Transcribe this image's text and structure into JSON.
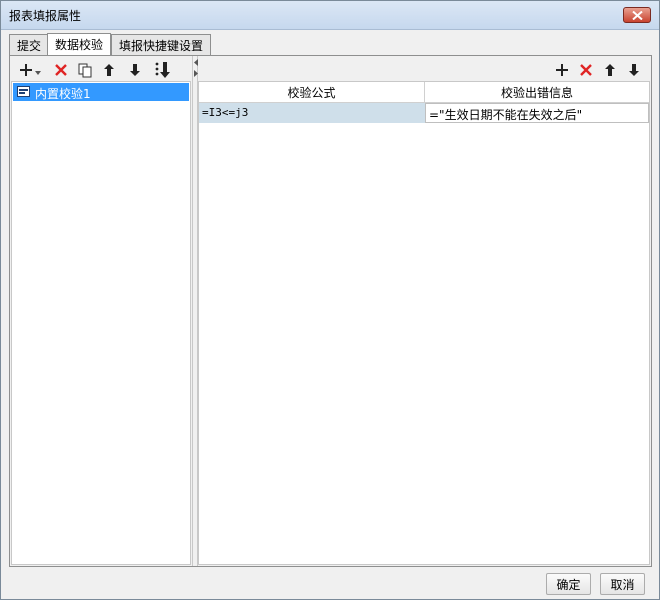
{
  "window": {
    "title": "报表填报属性"
  },
  "tabs": [
    {
      "label": "提交",
      "active": false
    },
    {
      "label": "数据校验",
      "active": true
    },
    {
      "label": "填报快捷键设置",
      "active": false
    }
  ],
  "left_list": {
    "items": [
      {
        "label": "内置校验1",
        "selected": true
      }
    ]
  },
  "grid": {
    "columns": [
      "校验公式",
      "校验出错信息"
    ],
    "rows": [
      {
        "formula": "=I3<=j3",
        "message": "=\"生效日期不能在失效之后\""
      }
    ]
  },
  "footer": {
    "ok_label": "确定",
    "cancel_label": "取消"
  },
  "colors": {
    "selection": "#3399ff",
    "delete": "#e02424",
    "formula_cell_bg": "#cfdfea"
  },
  "icons": [
    "add-icon",
    "dropdown-arrow-icon",
    "delete-icon",
    "copy-icon",
    "arrow-up-icon",
    "arrow-down-icon",
    "move-bottom-icon",
    "close-icon",
    "report-icon",
    "collapse-arrow-icon"
  ]
}
